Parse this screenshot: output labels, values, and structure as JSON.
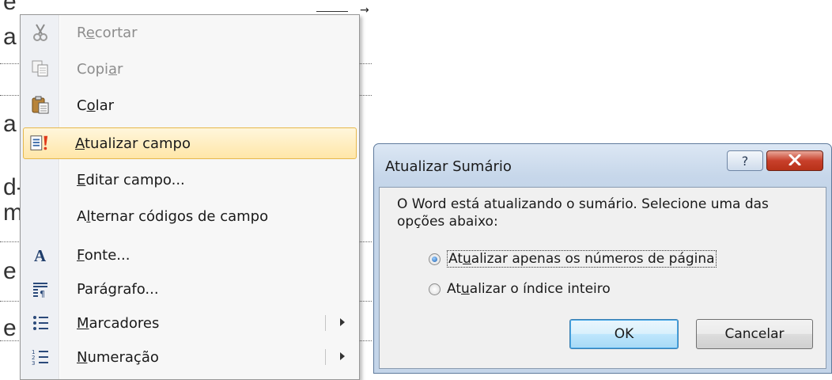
{
  "document": {
    "visible_letters": [
      "e",
      "a",
      "a",
      "d-",
      "m",
      "e",
      "e"
    ]
  },
  "context_menu": {
    "items": [
      {
        "label_pre": "R",
        "label_u": "e",
        "label_post": "cortar",
        "icon": "scissors-icon",
        "disabled": true
      },
      {
        "label_pre": "Copi",
        "label_u": "a",
        "label_post": "r",
        "icon": "copy-icon",
        "disabled": true
      },
      {
        "label_pre": "C",
        "label_u": "o",
        "label_post": "lar",
        "icon": "paste-icon",
        "disabled": false
      },
      {
        "label_pre": "",
        "label_u": "A",
        "label_post": "tualizar campo",
        "icon": "update-field-icon",
        "disabled": false,
        "highlighted": true
      },
      {
        "label_pre": "",
        "label_u": "E",
        "label_post": "ditar campo...",
        "icon": "",
        "disabled": false
      },
      {
        "label_pre": "A",
        "label_u": "l",
        "label_post": "ternar códigos de campo",
        "icon": "",
        "disabled": false
      },
      {
        "label_pre": "",
        "label_u": "F",
        "label_post": "onte...",
        "icon": "font-icon",
        "disabled": false
      },
      {
        "label_pre": "Pará",
        "label_u": "g",
        "label_post": "rafo...",
        "icon": "paragraph-icon",
        "disabled": false
      },
      {
        "label_pre": "",
        "label_u": "M",
        "label_post": "arcadores",
        "icon": "bullets-icon",
        "disabled": false,
        "submenu": true
      },
      {
        "label_pre": "",
        "label_u": "N",
        "label_post": "umeração",
        "icon": "numbering-icon",
        "disabled": false,
        "submenu": true
      }
    ]
  },
  "dialog": {
    "title": "Atualizar Sumário",
    "help_glyph": "?",
    "message": "O Word está atualizando o sumário. Selecione uma das opções abaixo:",
    "options": [
      {
        "label_pre": "At",
        "label_u": "u",
        "label_post": "alizar apenas os números de página",
        "checked": true
      },
      {
        "label_pre": "At",
        "label_u": "u",
        "label_post": "alizar o índice inteiro",
        "checked": false
      }
    ],
    "ok_label": "OK",
    "cancel_label": "Cancelar"
  }
}
